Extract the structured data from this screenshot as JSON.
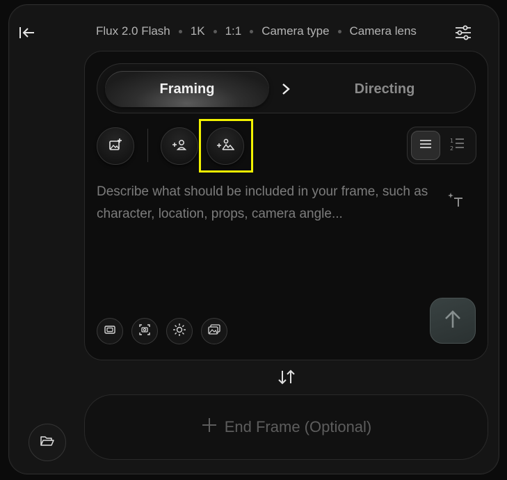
{
  "header": {
    "meta": [
      "Flux 2.0 Flash",
      "1K",
      "1:1",
      "Camera type",
      "Camera lens"
    ]
  },
  "mode_toggle": {
    "active_label": "Framing",
    "inactive_label": "Directing"
  },
  "prompt": {
    "placeholder": "Describe what should be included in your frame, such as character, location, props, camera angle..."
  },
  "end_frame": {
    "label": "End Frame (Optional)"
  },
  "colors": {
    "highlight": "#f2f200",
    "send_button": "#313a3a"
  },
  "icons": {
    "sidebar_toggle": "collapse-sidebar-icon",
    "settings": "sliders-icon",
    "add_image": "add-image-icon",
    "add_character": "add-character-icon",
    "add_scene": "add-scene-icon",
    "list_view": "list-icon",
    "numbered_view": "numbered-list-icon",
    "text_ai": "text-sparkle-icon",
    "send": "arrow-up-icon",
    "swap": "swap-vertical-icon",
    "folder": "folder-open-icon"
  }
}
